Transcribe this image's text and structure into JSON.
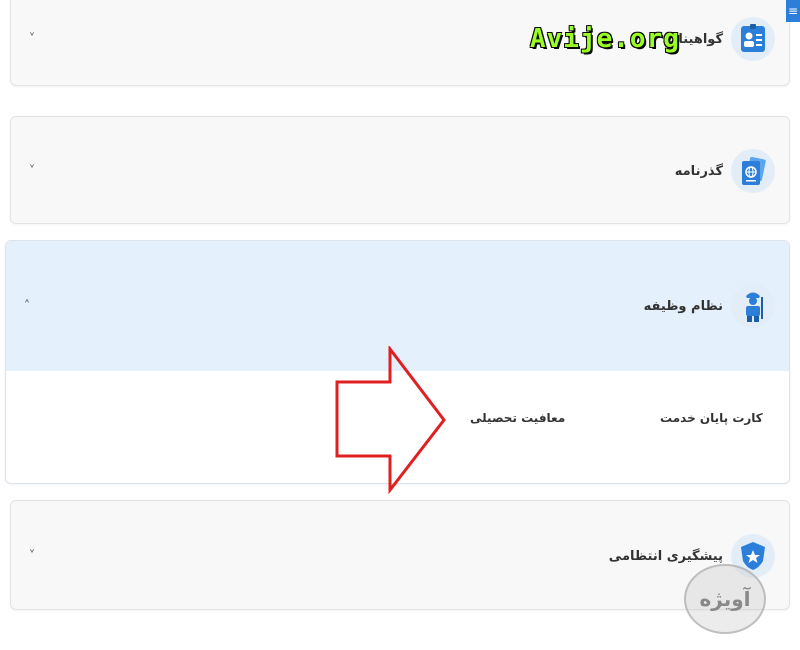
{
  "cards": [
    {
      "title": "گواهینامه",
      "icon": "license-card-icon",
      "chevron": "˅"
    },
    {
      "title": "گذرنامه",
      "icon": "passport-icon",
      "chevron": "˅"
    },
    {
      "title": "نظام وظیفه",
      "icon": "soldier-icon",
      "chevron": "˄",
      "expanded": true,
      "links": [
        "کارت پایان خدمت",
        "معافیت تحصیلی"
      ]
    },
    {
      "title": "پیشگیری انتظامی",
      "icon": "police-badge-icon",
      "chevron": "˅"
    }
  ],
  "menu": {
    "icon": "≡"
  },
  "watermarks": {
    "top": "Avije.org",
    "logo": "آویژه"
  },
  "colors": {
    "accent": "#2b7fd8",
    "expanded_header": "#e4f0fb",
    "arrow": "#e02020"
  }
}
